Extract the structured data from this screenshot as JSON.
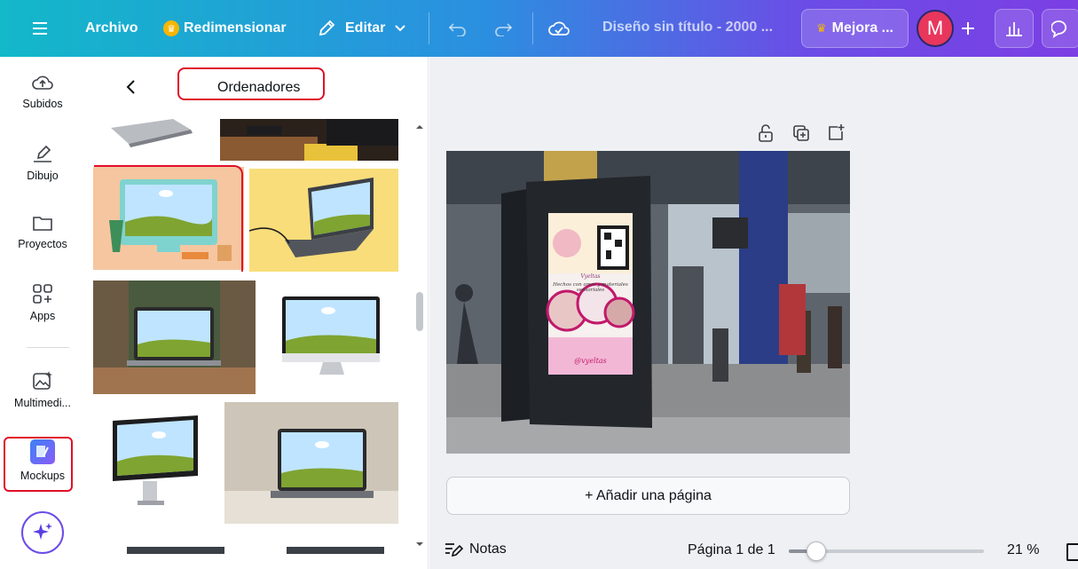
{
  "topbar": {
    "menu_icon": "hamburger-icon",
    "archivo": "Archivo",
    "redimensionar": "Redimensionar",
    "editar": "Editar",
    "doc_title": "Diseño sin título - 2000 ...",
    "mejora": "Mejora ...",
    "avatar_initial": "M"
  },
  "rail": {
    "items": [
      {
        "label": "Subidos",
        "icon": "cloud-upload-icon"
      },
      {
        "label": "Dibujo",
        "icon": "pen-icon"
      },
      {
        "label": "Proyectos",
        "icon": "folder-icon"
      },
      {
        "label": "Apps",
        "icon": "apps-icon"
      },
      {
        "label": "Multimedi...",
        "icon": "media-icon"
      },
      {
        "label": "Mockups",
        "icon": "mockups-icon"
      }
    ]
  },
  "panel": {
    "title": "Ordenadores"
  },
  "canvas": {
    "add_page": "+ Añadir una página"
  },
  "bottombar": {
    "notas": "Notas",
    "pagina": "Página 1 de 1",
    "zoom_label": "21 %",
    "zoom_value": 21
  },
  "poster": {
    "brand": "Vyeltas",
    "tagline": "Hechos con amor y materiales sensoriales",
    "handle": "@vyeltas"
  },
  "colors": {
    "accent": "#7b3fe4",
    "annotation": "#e0102a"
  }
}
